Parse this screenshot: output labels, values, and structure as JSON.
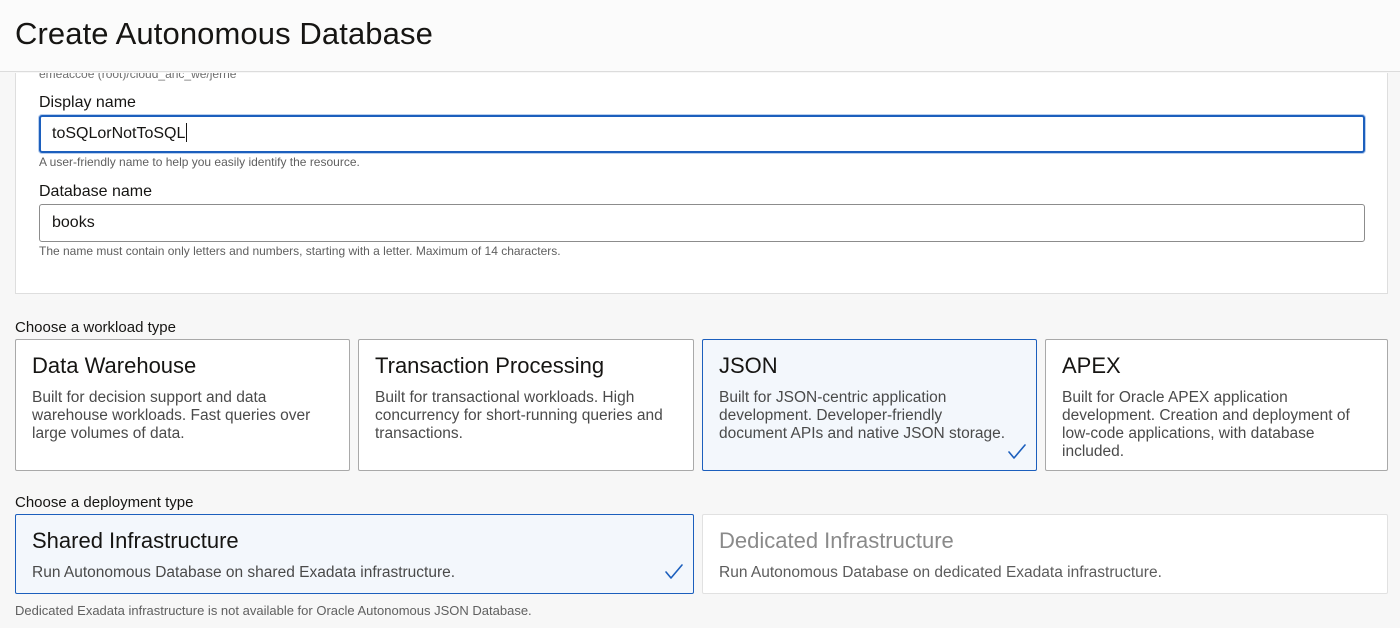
{
  "header": {
    "title": "Create Autonomous Database"
  },
  "basic": {
    "compartment_path": "emeaccoe (root)/cloud_anc_we/jerne",
    "display_name": {
      "label": "Display name",
      "value": "toSQLorNotToSQL",
      "hint": "A user-friendly name to help you easily identify the resource."
    },
    "database_name": {
      "label": "Database name",
      "value": "books",
      "hint": "The name must contain only letters and numbers, starting with a letter. Maximum of 14 characters."
    }
  },
  "workload": {
    "label": "Choose a workload type",
    "options": [
      {
        "title": "Data Warehouse",
        "description": "Built for decision support and data warehouse workloads. Fast queries over large volumes of data.",
        "selected": false
      },
      {
        "title": "Transaction Processing",
        "description": "Built for transactional workloads. High concurrency for short-running queries and transactions.",
        "selected": false
      },
      {
        "title": "JSON",
        "description": "Built for JSON-centric application development. Developer-friendly document APIs and native JSON storage.",
        "selected": true
      },
      {
        "title": "APEX",
        "description": "Built for Oracle APEX application development. Creation and deployment of low-code applications, with database included.",
        "selected": false
      }
    ]
  },
  "deployment": {
    "label": "Choose a deployment type",
    "options": [
      {
        "title": "Shared Infrastructure",
        "description": "Run Autonomous Database on shared Exadata infrastructure.",
        "selected": true,
        "disabled": false
      },
      {
        "title": "Dedicated Infrastructure",
        "description": "Run Autonomous Database on dedicated Exadata infrastructure.",
        "selected": false,
        "disabled": true
      }
    ],
    "note": "Dedicated Exadata infrastructure is not available for Oracle Autonomous JSON Database."
  },
  "colors": {
    "accent": "#1c5fbd",
    "selected_bg": "#f3f7fc"
  },
  "icons": {
    "selected": "checkmark-icon"
  }
}
